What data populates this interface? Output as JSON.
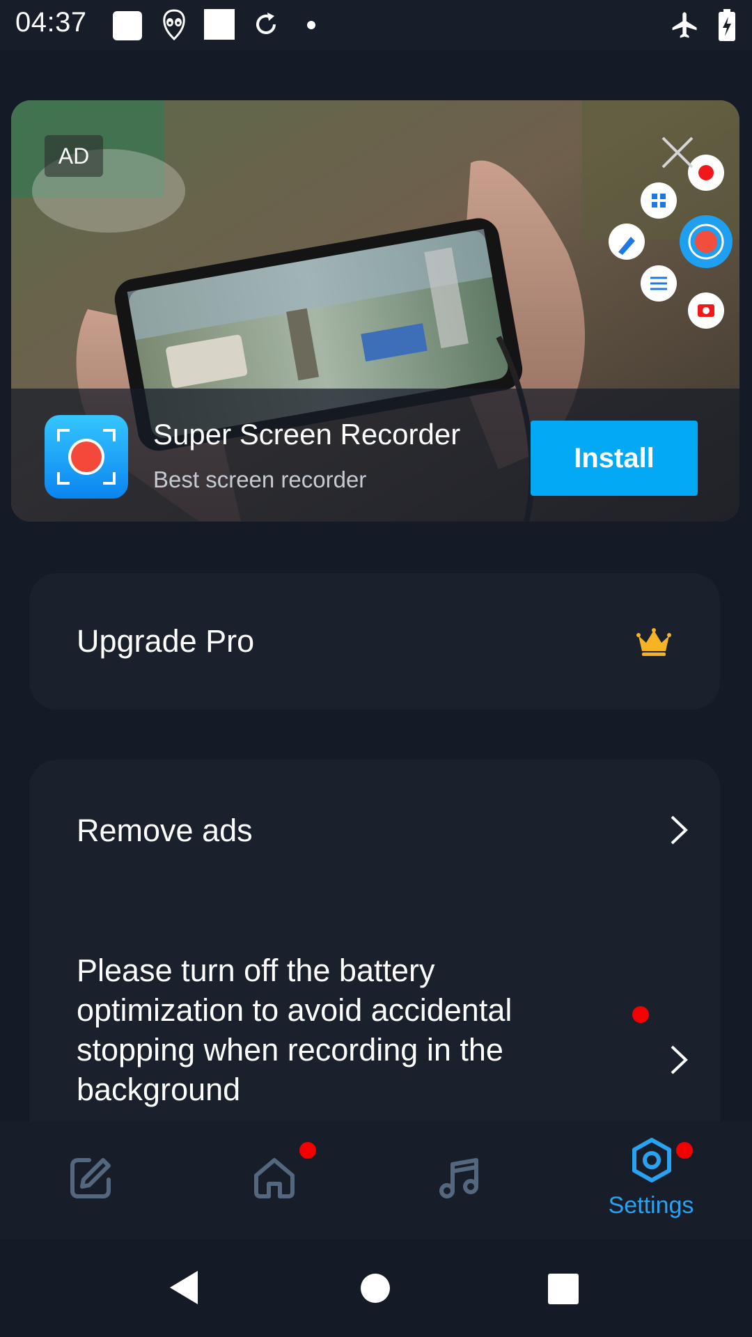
{
  "status_bar": {
    "time": "04:37",
    "left_icons": [
      "notification-square-icon",
      "alien-icon",
      "notification-square-icon",
      "sync-icon",
      "dot-icon"
    ],
    "right_icons": [
      "airplane-mode-icon",
      "battery-charging-icon"
    ]
  },
  "ad": {
    "badge": "AD",
    "app_name": "Super Screen Recorder",
    "app_subtitle": "Best screen recorder",
    "install_label": "Install",
    "accent_color": "#03a9f4"
  },
  "settings": {
    "upgrade_label": "Upgrade Pro",
    "remove_ads_label": "Remove ads",
    "battery_text": "Please turn off the battery optimization to avoid accidental stopping when recording in the background"
  },
  "bottom_nav": {
    "items": [
      {
        "icon": "edit-icon",
        "label": "",
        "active": false,
        "badge": false
      },
      {
        "icon": "home-icon",
        "label": "",
        "active": false,
        "badge": true
      },
      {
        "icon": "music-icon",
        "label": "",
        "active": false,
        "badge": false
      },
      {
        "icon": "settings-icon",
        "label": "Settings",
        "active": true,
        "badge": true
      }
    ],
    "active_color": "#29a3f1",
    "inactive_color": "#55677f",
    "badge_color": "#f40000"
  },
  "system_nav": [
    "back-icon",
    "home-circle-icon",
    "recents-icon"
  ]
}
